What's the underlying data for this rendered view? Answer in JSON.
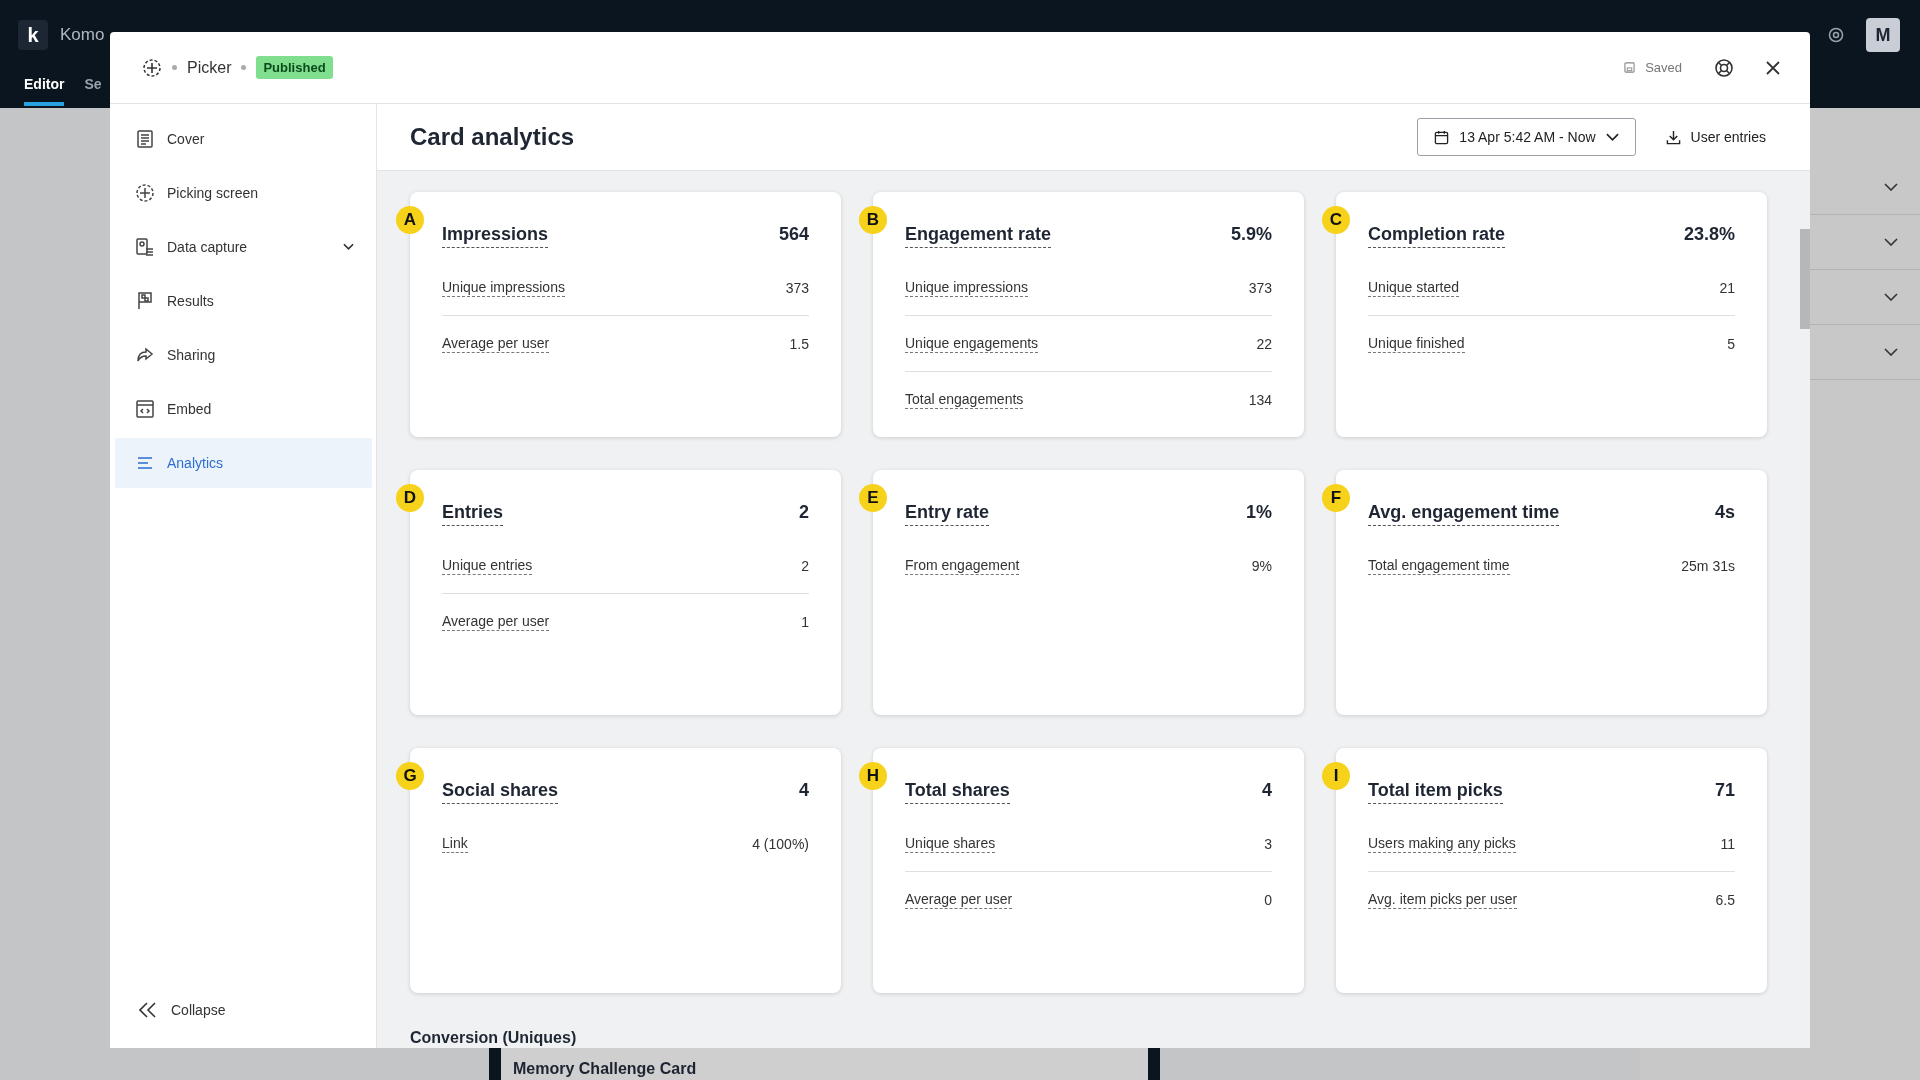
{
  "background_app": {
    "logo": "k",
    "project_title": "Komo",
    "tabs": [
      {
        "label": "Editor",
        "selected": true
      },
      {
        "label": "Se",
        "selected": false
      }
    ],
    "avatar": "M",
    "card_preview": "Memory Challenge Card"
  },
  "modal": {
    "breadcrumb": "Picker",
    "status": "Published",
    "saved": "Saved"
  },
  "sidebar": {
    "items": [
      {
        "label": "Cover",
        "selected": false
      },
      {
        "label": "Picking screen",
        "selected": false
      },
      {
        "label": "Data capture",
        "selected": false,
        "expanded": false
      },
      {
        "label": "Results",
        "selected": false
      },
      {
        "label": "Sharing",
        "selected": false
      },
      {
        "label": "Embed",
        "selected": false
      },
      {
        "label": "Analytics",
        "selected": true
      }
    ],
    "collapse": "Collapse"
  },
  "header": {
    "title": "Card analytics",
    "date_range": "13 Apr 5:42 AM - Now",
    "export": "User entries"
  },
  "cards": [
    {
      "badge": "A",
      "title": "Impressions",
      "value": "564",
      "rows": [
        {
          "label": "Unique impressions",
          "value": "373"
        },
        {
          "label": "Average per user",
          "value": "1.5"
        }
      ]
    },
    {
      "badge": "B",
      "title": "Engagement rate",
      "value": "5.9%",
      "rows": [
        {
          "label": "Unique impressions",
          "value": "373"
        },
        {
          "label": "Unique engagements",
          "value": "22"
        },
        {
          "label": "Total engagements",
          "value": "134"
        }
      ]
    },
    {
      "badge": "C",
      "title": "Completion rate",
      "value": "23.8%",
      "rows": [
        {
          "label": "Unique started",
          "value": "21"
        },
        {
          "label": "Unique finished",
          "value": "5"
        }
      ]
    },
    {
      "badge": "D",
      "title": "Entries",
      "value": "2",
      "rows": [
        {
          "label": "Unique entries",
          "value": "2"
        },
        {
          "label": "Average per user",
          "value": "1"
        }
      ]
    },
    {
      "badge": "E",
      "title": "Entry rate",
      "value": "1%",
      "rows": [
        {
          "label": "From engagement",
          "value": "9%"
        }
      ]
    },
    {
      "badge": "F",
      "title": "Avg. engagement time",
      "value": "4s",
      "rows": [
        {
          "label": "Total engagement time",
          "value": "25m 31s"
        }
      ]
    },
    {
      "badge": "G",
      "title": "Social shares",
      "value": "4",
      "rows": [
        {
          "label": "Link",
          "value": "4 (100%)"
        }
      ]
    },
    {
      "badge": "H",
      "title": "Total shares",
      "value": "4",
      "rows": [
        {
          "label": "Unique shares",
          "value": "3"
        },
        {
          "label": "Average per user",
          "value": "0"
        }
      ]
    },
    {
      "badge": "I",
      "title": "Total item picks",
      "value": "71",
      "rows": [
        {
          "label": "Users making any picks",
          "value": "11"
        },
        {
          "label": "Avg. item picks per user",
          "value": "6.5"
        }
      ]
    }
  ],
  "section_heading": "Conversion (Uniques)"
}
